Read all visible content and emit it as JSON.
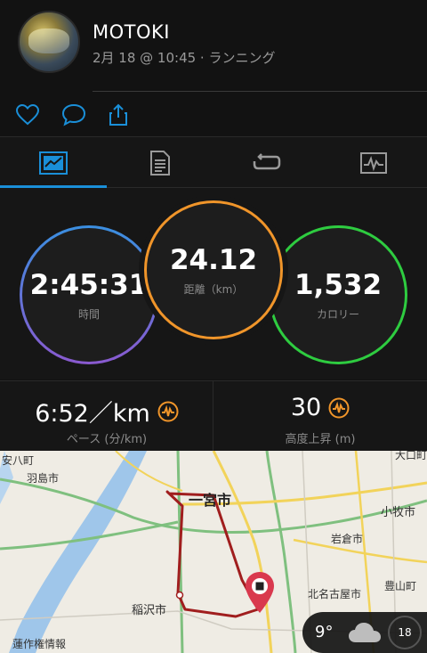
{
  "header": {
    "username": "MOTOKI",
    "subline": "2月 18 @ 10:45 · ランニング"
  },
  "tabs": [
    "summary-icon",
    "details-icon",
    "laps-icon",
    "charts-icon"
  ],
  "stats": {
    "time": {
      "value": "2:45:31",
      "label": "時間"
    },
    "distance": {
      "value": "24.12",
      "label": "距離（km）"
    },
    "calories": {
      "value": "1,532",
      "label": "カロリー"
    }
  },
  "metrics": {
    "pace": {
      "value": "6:52／km",
      "label": "ペース (分/km)"
    },
    "elevation": {
      "value": "30",
      "label": "高度上昇 (m)"
    }
  },
  "map": {
    "labels": {
      "ichinomiya": "一宮市",
      "hashima": "羽島市",
      "anpachi": "安八町",
      "inazawa": "稲沢市",
      "iwakura": "岩倉市",
      "komaki": "小牧市",
      "kitanagoya": "北名古屋市",
      "toyoyama": "豊山町",
      "oguchi": "大口町",
      "tsushima": "蓮作権情報"
    },
    "weather": {
      "temp": "9°",
      "day": "18"
    }
  },
  "colors": {
    "time_ring": "#6a5acd",
    "distance_ring": "#f0952a",
    "calories_ring": "#2ecc40",
    "accent": "#1a8fd8",
    "route": "#a01e1e"
  }
}
